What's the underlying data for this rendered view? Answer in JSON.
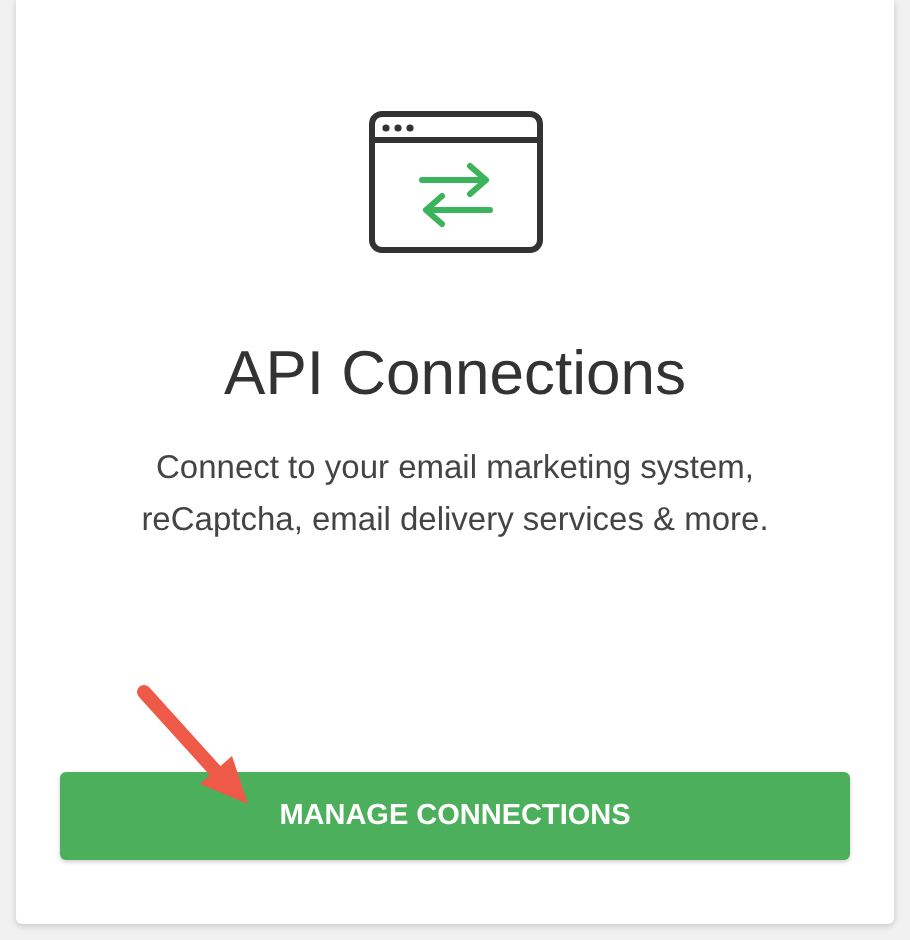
{
  "card": {
    "title": "API Connections",
    "description": "Connect to your email marketing system, reCaptcha, email delivery services & more.",
    "button": {
      "label": "MANAGE CONNECTIONS"
    },
    "annotation_arrow": true
  }
}
